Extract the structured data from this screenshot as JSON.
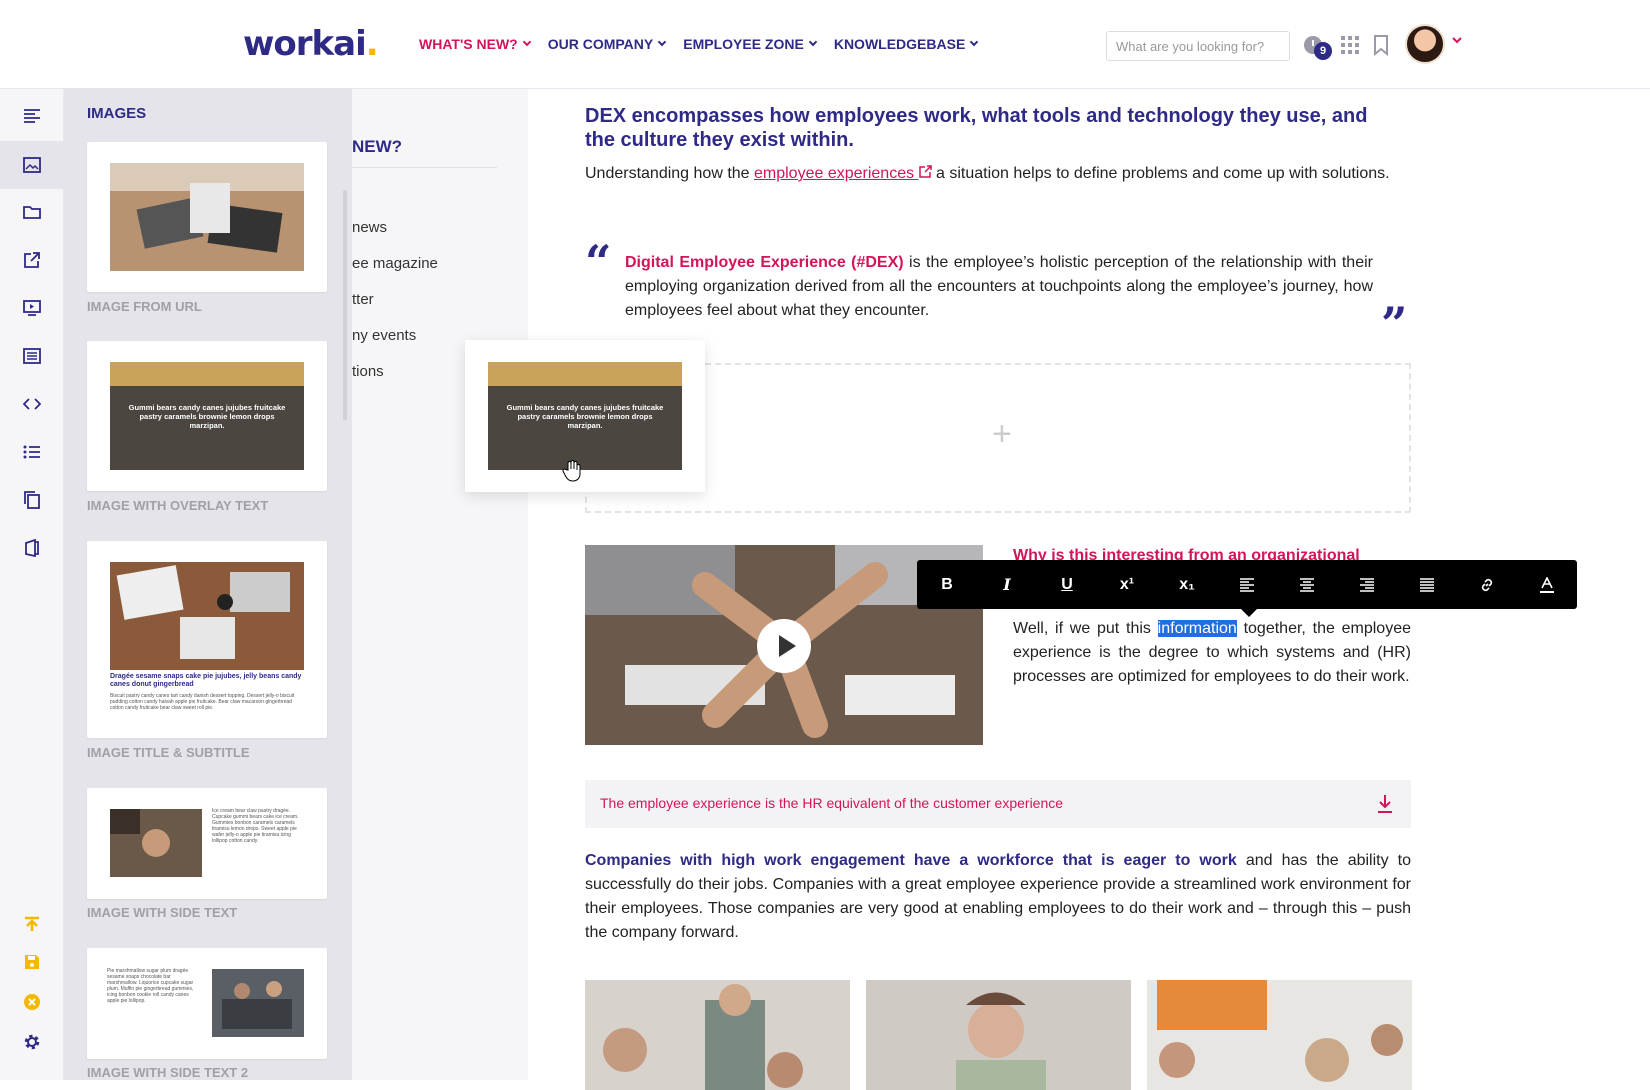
{
  "brand": {
    "logo_text": "workai",
    "logo_dot": ".",
    "accent": "#d4145a",
    "primary": "#2e2a86",
    "yellow": "#f5b800"
  },
  "nav": {
    "items": [
      {
        "label": "WHAT'S NEW?",
        "active": true
      },
      {
        "label": "OUR COMPANY"
      },
      {
        "label": "EMPLOYEE ZONE"
      },
      {
        "label": "KNOWLEDGEBASE"
      }
    ]
  },
  "search": {
    "placeholder": "What are you looking for?"
  },
  "notifications": {
    "count": "9"
  },
  "rail": {
    "icons": [
      "text-align-icon",
      "image-icon",
      "folder-icon",
      "external-link-icon",
      "video-icon",
      "form-icon",
      "code-icon",
      "list-icon",
      "copy-icon",
      "office-icon"
    ],
    "bottom_icons": [
      "publish-icon",
      "save-icon",
      "cancel-icon",
      "settings-icon"
    ]
  },
  "panel": {
    "title": "IMAGES",
    "items": [
      {
        "label": "IMAGE FROM URL"
      },
      {
        "label": "IMAGE WITH OVERLAY TEXT",
        "overlay": "Gummi bears candy canes jujubes fruitcake pastry caramels brownie lemon drops marzipan."
      },
      {
        "label": "IMAGE TITLE & SUBTITLE",
        "title": "Dragée sesame snaps cake pie jujubes, jelly beans candy canes donut gingerbread",
        "subtitle": "Biscuit pastry candy canes tart candy danish dessert topping. Dessert jelly-o biscuit pudding cotton candy halvah apple pie fruitcake. Bear claw macaroon gingerbread cotton candy fruitcake bear claw sweet roll pie."
      },
      {
        "label": "IMAGE WITH SIDE TEXT",
        "side": "Ice cream bear claw pastry dragée. Cupcake gummi bears cake ice cream. Gummies bonbon caramels caramels tiramisu lemon drops. Sweet apple pie wafer jelly-o apple pie tiramisu icing lollipop cotton candy."
      },
      {
        "label": "IMAGE WITH SIDE TEXT 2",
        "side": "Pie marshmallow sugar plum dragée sesame snaps chocolate bar marshmallow. Liquorice cupcake sugar plum. Muffin pie gingerbread gummies, icing bonbon cookie roll candy canes apple pie lollipop."
      }
    ]
  },
  "menu": {
    "heading": "NEW?",
    "items": [
      "news",
      "ee magazine",
      "tter",
      "ny events",
      "tions"
    ]
  },
  "drag_overlay": "Gummi bears candy canes jujubes fruitcake pastry caramels brownie lemon drops marzipan.",
  "article": {
    "heading": "DEX encompasses how employees work, what tools and technology they use, and the culture they exist within.",
    "intro_before": "Understanding how the ",
    "intro_link": "employee experiences",
    "intro_after": " a situation helps to define problems and come up with solutions.",
    "quote_term": "Digital Employee Experience (#DEX)",
    "quote_body": " is the employee’s holistic perception of the relationship with their employing organization derived from all the encounters at touchpoints along the employee’s journey, how employees feel about what they encounter.",
    "side_title": "Why is this interesting from an organizational",
    "side_before": "Well, if we put this ",
    "side_highlight": "information",
    "side_after": " together, the employee experience is the degree to which systems and (HR) processes are optimized for employees to do their work.",
    "download_text": "The employee experience is the HR equivalent of the customer experience",
    "para_bold": "Companies with high work engagement have a workforce that is eager to work",
    "para_rest": " and has the ability to successfully do their jobs. Companies with a great employee experience provide a streamlined work environment for their employees. Those companies are very good at enabling employees to do their work and – through this – push the company forward."
  },
  "toolbar": {
    "buttons": [
      {
        "label": "B",
        "name": "bold-button"
      },
      {
        "label": "I",
        "name": "italic-button"
      },
      {
        "label": "U",
        "name": "underline-button"
      },
      {
        "label": "x¹",
        "name": "superscript-button"
      },
      {
        "label": "x₁",
        "name": "subscript-button"
      }
    ],
    "icons": [
      "align-left-icon",
      "align-center-icon",
      "align-right-icon",
      "align-justify-icon",
      "link-icon",
      "text-color-icon"
    ]
  }
}
